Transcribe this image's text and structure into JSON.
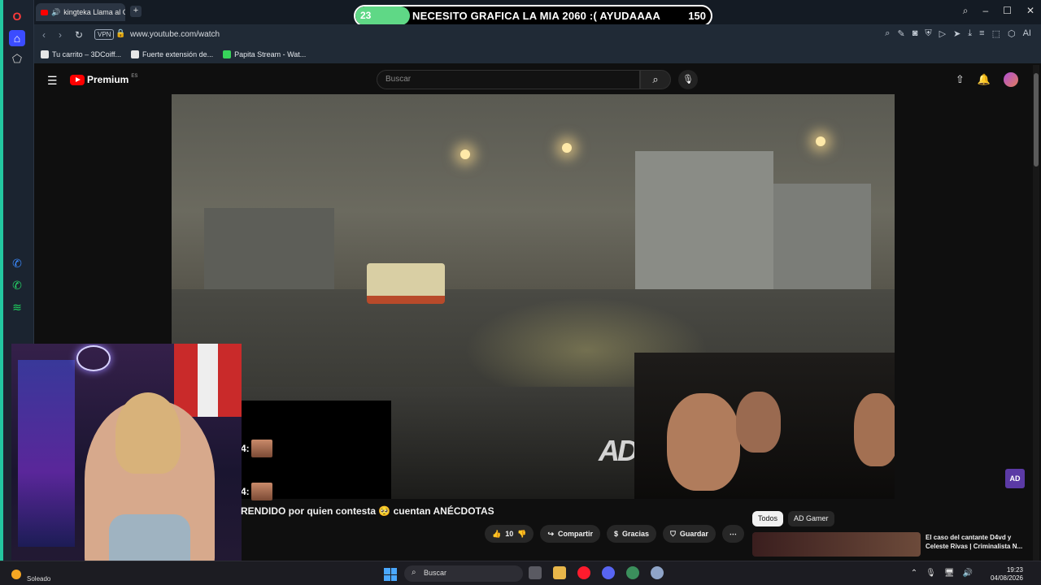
{
  "browser": {
    "tab_title": "kingteka Llama al CEV",
    "url": "www.youtube.com/watch",
    "vpn_label": "VPN",
    "bookmarks": [
      {
        "label": "Tu carrito – 3DCoiff..."
      },
      {
        "label": "Fuerte extensión de..."
      },
      {
        "label": "Papita Stream - Wat..."
      }
    ]
  },
  "goal_overlay": {
    "current": "23",
    "message": "NECESITO GRAFICA LA MIA 2060 :( AYUDAAAA",
    "target": "150",
    "progress_fraction": 0.153,
    "fill_color": "#5fd886"
  },
  "youtube": {
    "brand": "Premium",
    "region": "ES",
    "search_placeholder": "Buscar",
    "video_title": "RENDIDO por quien contesta 🥺 cuentan ANÉCDOTAS",
    "watermark": "AD",
    "channel_badge": "AD",
    "like_count": "10",
    "share_label": "Compartir",
    "thanks_label": "Gracias",
    "save_label": "Guardar",
    "more_label": "⋯",
    "chips": [
      {
        "label": "Todos",
        "active": true
      },
      {
        "label": "AD Gamer",
        "active": false
      }
    ],
    "recommended": {
      "title": "El caso del cantante D4vd y Celeste Rivas | Criminalista N..."
    },
    "accent_color": "#ff0000"
  },
  "chat_widget": {
    "rows": [
      {
        "prefix": "4:"
      },
      {
        "prefix": "4:"
      }
    ]
  },
  "taskbar": {
    "weather": "Soleado",
    "search_placeholder": "Buscar",
    "time": "19:23",
    "date": "04/08/2026"
  }
}
